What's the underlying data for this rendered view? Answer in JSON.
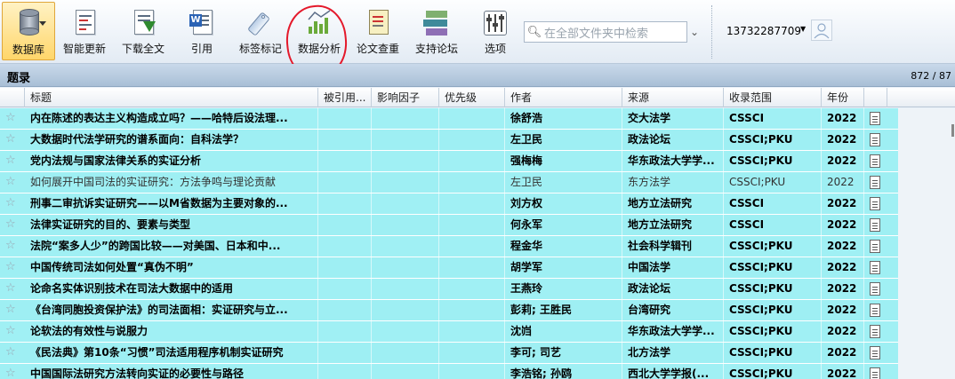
{
  "toolbar": {
    "buttons": [
      {
        "label": "数据库",
        "icon": "database-icon"
      },
      {
        "label": "智能更新",
        "icon": "smart-update-icon"
      },
      {
        "label": "下载全文",
        "icon": "download-fulltext-icon"
      },
      {
        "label": "引用",
        "icon": "cite-icon"
      },
      {
        "label": "标签标记",
        "icon": "tag-icon"
      },
      {
        "label": "数据分析",
        "icon": "data-analysis-icon"
      },
      {
        "label": "论文查重",
        "icon": "plagiarism-check-icon"
      },
      {
        "label": "支持论坛",
        "icon": "forum-icon"
      },
      {
        "label": "选项",
        "icon": "options-icon"
      }
    ],
    "search_placeholder": "在全部文件夹中检索",
    "user": "13732287709",
    "annotation_color": "#e4192b"
  },
  "section": {
    "title": "题录",
    "count": "872 / 87"
  },
  "columns": [
    "",
    "标题",
    "被引用...",
    "影响因子",
    "优先级",
    "作者",
    "来源",
    "收录范围",
    "年份",
    ""
  ],
  "rows": [
    {
      "title": "内在陈述的表达主义构造成立吗？——哈特后设法理...",
      "author": "徐舒浩",
      "source": "交大法学",
      "scope": "CSSCI",
      "year": "2022",
      "bold": true
    },
    {
      "title": "大数据时代法学研究的谱系面向：自科法学？",
      "author": "左卫民",
      "source": "政法论坛",
      "scope": "CSSCI;PKU",
      "year": "2022",
      "bold": true
    },
    {
      "title": "党内法规与国家法律关系的实证分析",
      "author": "强梅梅",
      "source": "华东政法大学学...",
      "scope": "CSSCI;PKU",
      "year": "2022",
      "bold": true
    },
    {
      "title": "如何展开中国司法的实证研究：方法争鸣与理论贡献",
      "author": "左卫民",
      "source": "东方法学",
      "scope": "CSSCI;PKU",
      "year": "2022",
      "bold": false
    },
    {
      "title": "刑事二审抗诉实证研究——以M省数据为主要对象的...",
      "author": "刘方权",
      "source": "地方立法研究",
      "scope": "CSSCI",
      "year": "2022",
      "bold": true
    },
    {
      "title": "法律实证研究的目的、要素与类型",
      "author": "何永军",
      "source": "地方立法研究",
      "scope": "CSSCI",
      "year": "2022",
      "bold": true
    },
    {
      "title": "法院“案多人少”的跨国比较——对美国、日本和中...",
      "author": "程金华",
      "source": "社会科学辑刊",
      "scope": "CSSCI;PKU",
      "year": "2022",
      "bold": true
    },
    {
      "title": "中国传统司法如何处置“真伪不明”",
      "author": "胡学军",
      "source": "中国法学",
      "scope": "CSSCI;PKU",
      "year": "2022",
      "bold": true
    },
    {
      "title": "论命名实体识别技术在司法大数据中的适用",
      "author": "王燕玲",
      "source": "政法论坛",
      "scope": "CSSCI;PKU",
      "year": "2022",
      "bold": true
    },
    {
      "title": "《台湾同胞投资保护法》的司法面相：实证研究与立...",
      "author": "彭莉; 王胜民",
      "source": "台湾研究",
      "scope": "CSSCI;PKU",
      "year": "2022",
      "bold": true
    },
    {
      "title": "论软法的有效性与说服力",
      "author": "沈岿",
      "source": "华东政法大学学...",
      "scope": "CSSCI;PKU",
      "year": "2022",
      "bold": true
    },
    {
      "title": "《民法典》第10条“习惯”司法适用程序机制实证研究",
      "author": "李可; 司艺",
      "source": "北方法学",
      "scope": "CSSCI;PKU",
      "year": "2022",
      "bold": true
    },
    {
      "title": "中国国际法研究方法转向实证的必要性与路径",
      "author": "李浩铭; 孙鸥",
      "source": "西北大学学报(...",
      "scope": "CSSCI;PKU",
      "year": "2022",
      "bold": true
    }
  ]
}
